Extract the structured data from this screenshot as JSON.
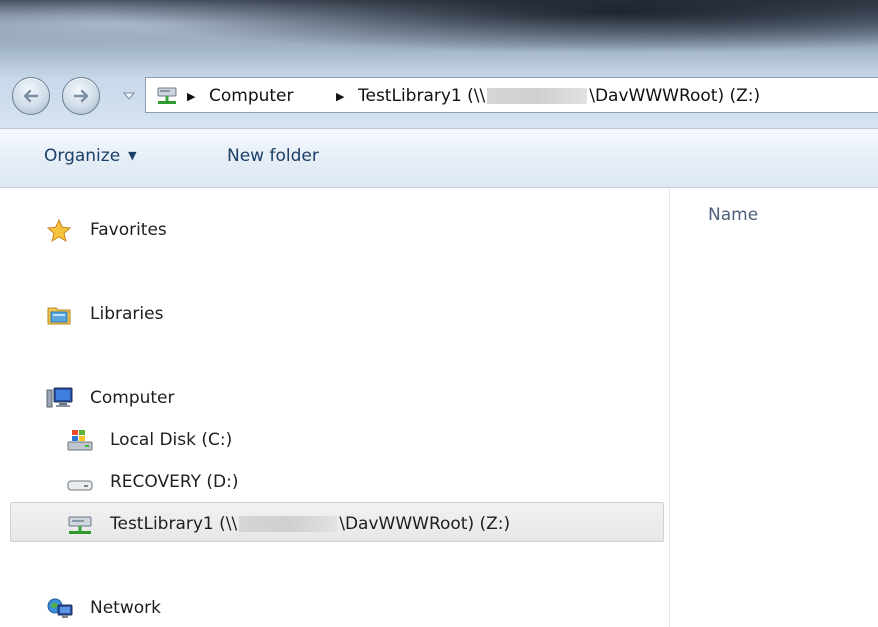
{
  "address_bar": {
    "crumb_computer": "Computer",
    "crumb_library_prefix": "TestLibrary1 (\\\\",
    "crumb_library_suffix": "\\DavWWWRoot) (Z:)"
  },
  "toolbar": {
    "organize_label": "Organize",
    "new_folder_label": "New folder"
  },
  "nav": {
    "favorites": "Favorites",
    "libraries": "Libraries",
    "computer": "Computer",
    "local_disk": "Local Disk (C:)",
    "recovery": "RECOVERY (D:)",
    "testlibrary_prefix": "TestLibrary1 (\\\\",
    "testlibrary_suffix": "\\DavWWWRoot) (Z:)",
    "network": "Network"
  },
  "content": {
    "column_name": "Name"
  },
  "icons": {
    "back": "back-arrow-icon",
    "forward": "forward-arrow-icon",
    "network_drive": "network-drive-icon",
    "star": "star-icon",
    "libraries": "libraries-folder-icon",
    "computer": "computer-icon",
    "local_disk": "windows-disk-icon",
    "drive": "drive-icon",
    "network": "network-globe-icon"
  },
  "colors": {
    "toolbar_text": "#1b3f66",
    "selection": "#e7e7e7",
    "header_text": "#4c607a"
  }
}
